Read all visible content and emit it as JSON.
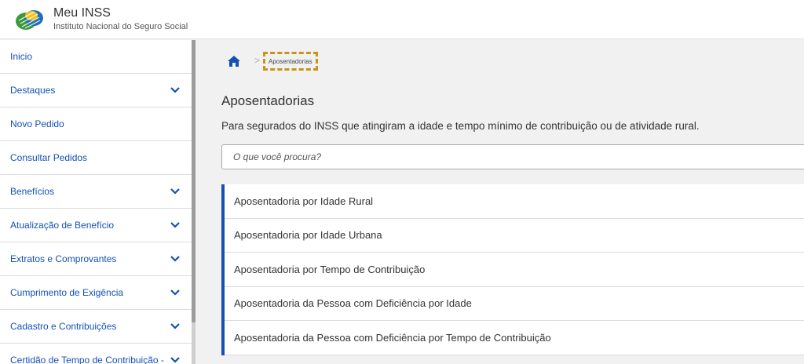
{
  "header": {
    "title": "Meu INSS",
    "subtitle": "Instituto Nacional do Seguro Social"
  },
  "colors": {
    "accent": "#1351b4",
    "highlight_border": "#c89419",
    "logo_green": "#3a9a3c",
    "logo_blue": "#1f6fb5",
    "logo_yellow": "#f2c21b"
  },
  "sidebar": {
    "items": [
      {
        "label": "Inicio",
        "has_chevron": false
      },
      {
        "label": "Destaques",
        "has_chevron": true
      },
      {
        "label": "Novo Pedido",
        "has_chevron": false
      },
      {
        "label": "Consultar Pedidos",
        "has_chevron": false
      },
      {
        "label": "Benefícios",
        "has_chevron": true
      },
      {
        "label": "Atualização de Benefício",
        "has_chevron": true
      },
      {
        "label": "Extratos e Comprovantes",
        "has_chevron": true
      },
      {
        "label": "Cumprimento de Exigência",
        "has_chevron": true
      },
      {
        "label": "Cadastro e Contribuições",
        "has_chevron": true
      },
      {
        "label": "Certidão de Tempo de Contribuição -",
        "has_chevron": true
      }
    ]
  },
  "breadcrumb": {
    "home_icon": "home-icon",
    "separator": ">",
    "current": "Aposentadorias"
  },
  "main": {
    "title": "Aposentadorias",
    "description": "Para segurados do INSS que atingiram a idade e tempo mínimo de contribuição ou de atividade rural.",
    "search_placeholder": "O que você procura?",
    "items": [
      "Aposentadoria por Idade Rural",
      "Aposentadoria por Idade Urbana",
      "Aposentadoria por Tempo de Contribuição",
      "Aposentadoria da Pessoa com Deficiência por Idade",
      "Aposentadoria da Pessoa com Deficiência por Tempo de Contribuição"
    ]
  }
}
